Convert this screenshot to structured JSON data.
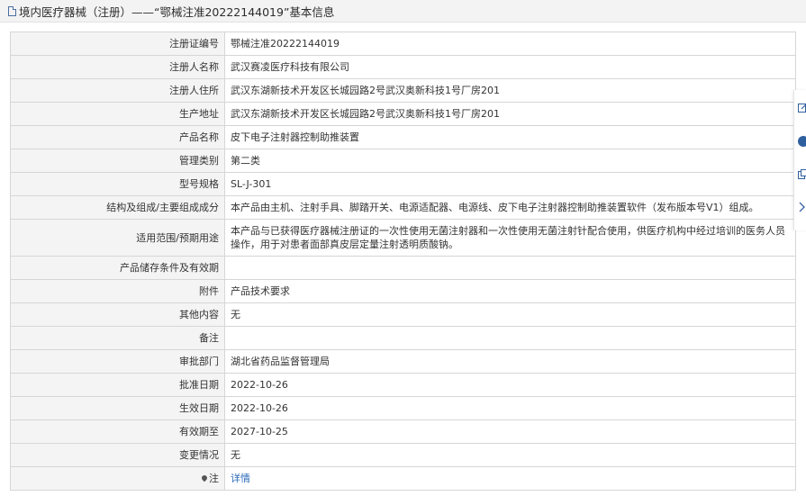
{
  "header": {
    "title": "境内医疗器械（注册）——“鄂械注准20222144019”基本信息"
  },
  "rows": [
    {
      "label": "注册证编号",
      "value": "鄂械注准20222144019"
    },
    {
      "label": "注册人名称",
      "value": "武汉赛凌医疗科技有限公司"
    },
    {
      "label": "注册人住所",
      "value": "武汉东湖新技术开发区长城园路2号武汉奥新科技1号厂房201"
    },
    {
      "label": "生产地址",
      "value": "武汉东湖新技术开发区长城园路2号武汉奥新科技1号厂房201"
    },
    {
      "label": "产品名称",
      "value": "皮下电子注射器控制助推装置"
    },
    {
      "label": "管理类别",
      "value": "第二类"
    },
    {
      "label": "型号规格",
      "value": "SL-J-301"
    },
    {
      "label": "结构及组成/主要组成成分",
      "value": "本产品由主机、注射手具、脚踏开关、电源适配器、电源线、皮下电子注射器控制助推装置软件（发布版本号V1）组成。"
    },
    {
      "label": "适用范围/预期用途",
      "value": "本产品与已获得医疗器械注册证的一次性使用无菌注射器和一次性使用无菌注射针配合使用，供医疗机构中经过培训的医务人员操作，用于对患者面部真皮层定量注射透明质酸钠。"
    },
    {
      "label": "产品储存条件及有效期",
      "value": ""
    },
    {
      "label": "附件",
      "value": "产品技术要求"
    },
    {
      "label": "其他内容",
      "value": "无"
    },
    {
      "label": "备注",
      "value": ""
    },
    {
      "label": "审批部门",
      "value": "湖北省药品监督管理局"
    },
    {
      "label": "批准日期",
      "value": "2022-10-26"
    },
    {
      "label": "生效日期",
      "value": "2022-10-26"
    },
    {
      "label": "有效期至",
      "value": "2027-10-25"
    },
    {
      "label": "变更情况",
      "value": "无"
    },
    {
      "label": "注",
      "value": "详情"
    }
  ],
  "side_tools": {
    "tool1_icon": "edit-icon",
    "tool2_icon": "help-icon",
    "tool3_icon": "copy-icon",
    "tool4_icon": "chevron-right-icon",
    "help_glyph": "?"
  },
  "colors": {
    "label_bg": "#f4f4f4",
    "border": "#d6d6d6",
    "link": "#2a6ab8",
    "header_bg": "#f3f3f3"
  }
}
